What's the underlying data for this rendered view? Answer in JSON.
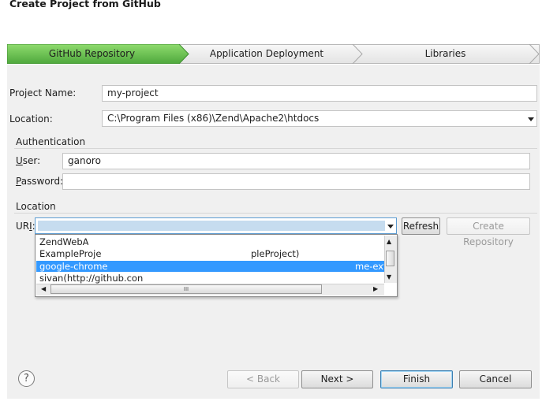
{
  "dialog": {
    "title": "Create Project from GitHub"
  },
  "wizard": {
    "steps": [
      "GitHub Repository",
      "Application Deployment",
      "Libraries"
    ],
    "active_color": "#5fb84c"
  },
  "form": {
    "project_name_label": "Project Name:",
    "project_name_value": "my-project",
    "location_label": "Location:",
    "location_value": "C:\\Program Files (x86)\\Zend\\Apache2\\htdocs"
  },
  "authentication": {
    "group_label": "Authentication",
    "user_label": "User:",
    "user_value": "ganoro",
    "password_label": "Password:",
    "password_value": ""
  },
  "location_group": {
    "group_label": "Location",
    "uri_label": "URI:",
    "refresh_button": "Refresh",
    "create_repository_button": "Create Repository",
    "dropdown_items": [
      "ZendWebA",
      "ExampleProje",
      "google-chrome",
      "sivan(http://github.con"
    ],
    "dropdown_right_fragments": [
      "pleProject)",
      "me-ext"
    ],
    "scroll_mid": "III"
  },
  "footer": {
    "help_label": "?",
    "back_button": "< Back",
    "next_button": "Next >",
    "finish_button": "Finish",
    "cancel_button": "Cancel"
  }
}
